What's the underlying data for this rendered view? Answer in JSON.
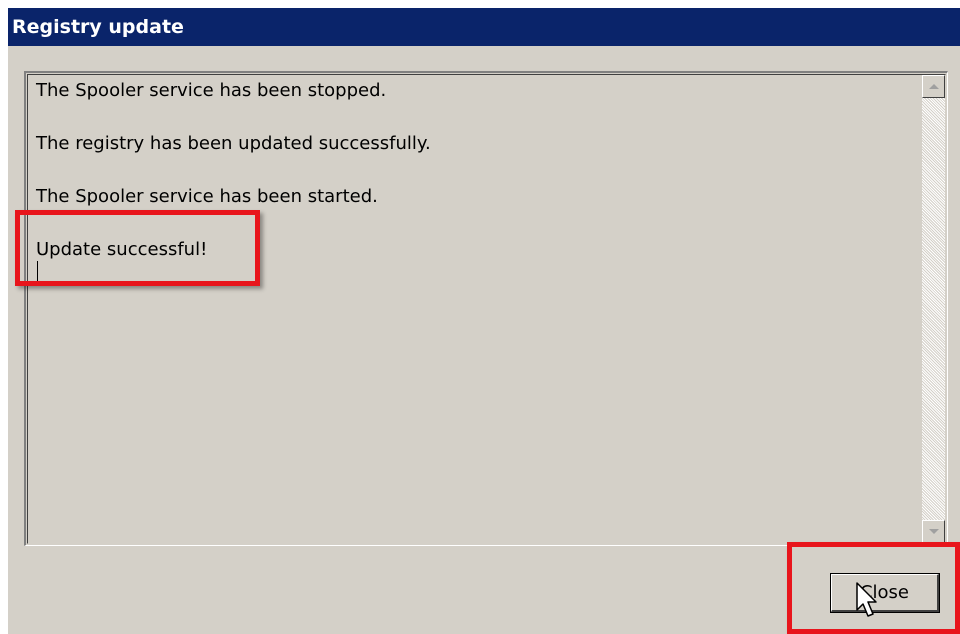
{
  "window": {
    "title": "Registry update"
  },
  "log": {
    "lines": [
      "The Spooler service has been stopped.",
      "The registry has been updated successfully.",
      "The Spooler service has been started.",
      "Update successful!"
    ]
  },
  "buttons": {
    "close_label": "Close"
  },
  "colors": {
    "titlebar": "#0a246a",
    "dialog_bg": "#d4d0c8",
    "highlight": "#e8151c"
  },
  "icons": {
    "cursor": "mouse-pointer-icon",
    "scroll_up": "scroll-up-arrow-icon",
    "scroll_down": "scroll-down-arrow-icon"
  }
}
